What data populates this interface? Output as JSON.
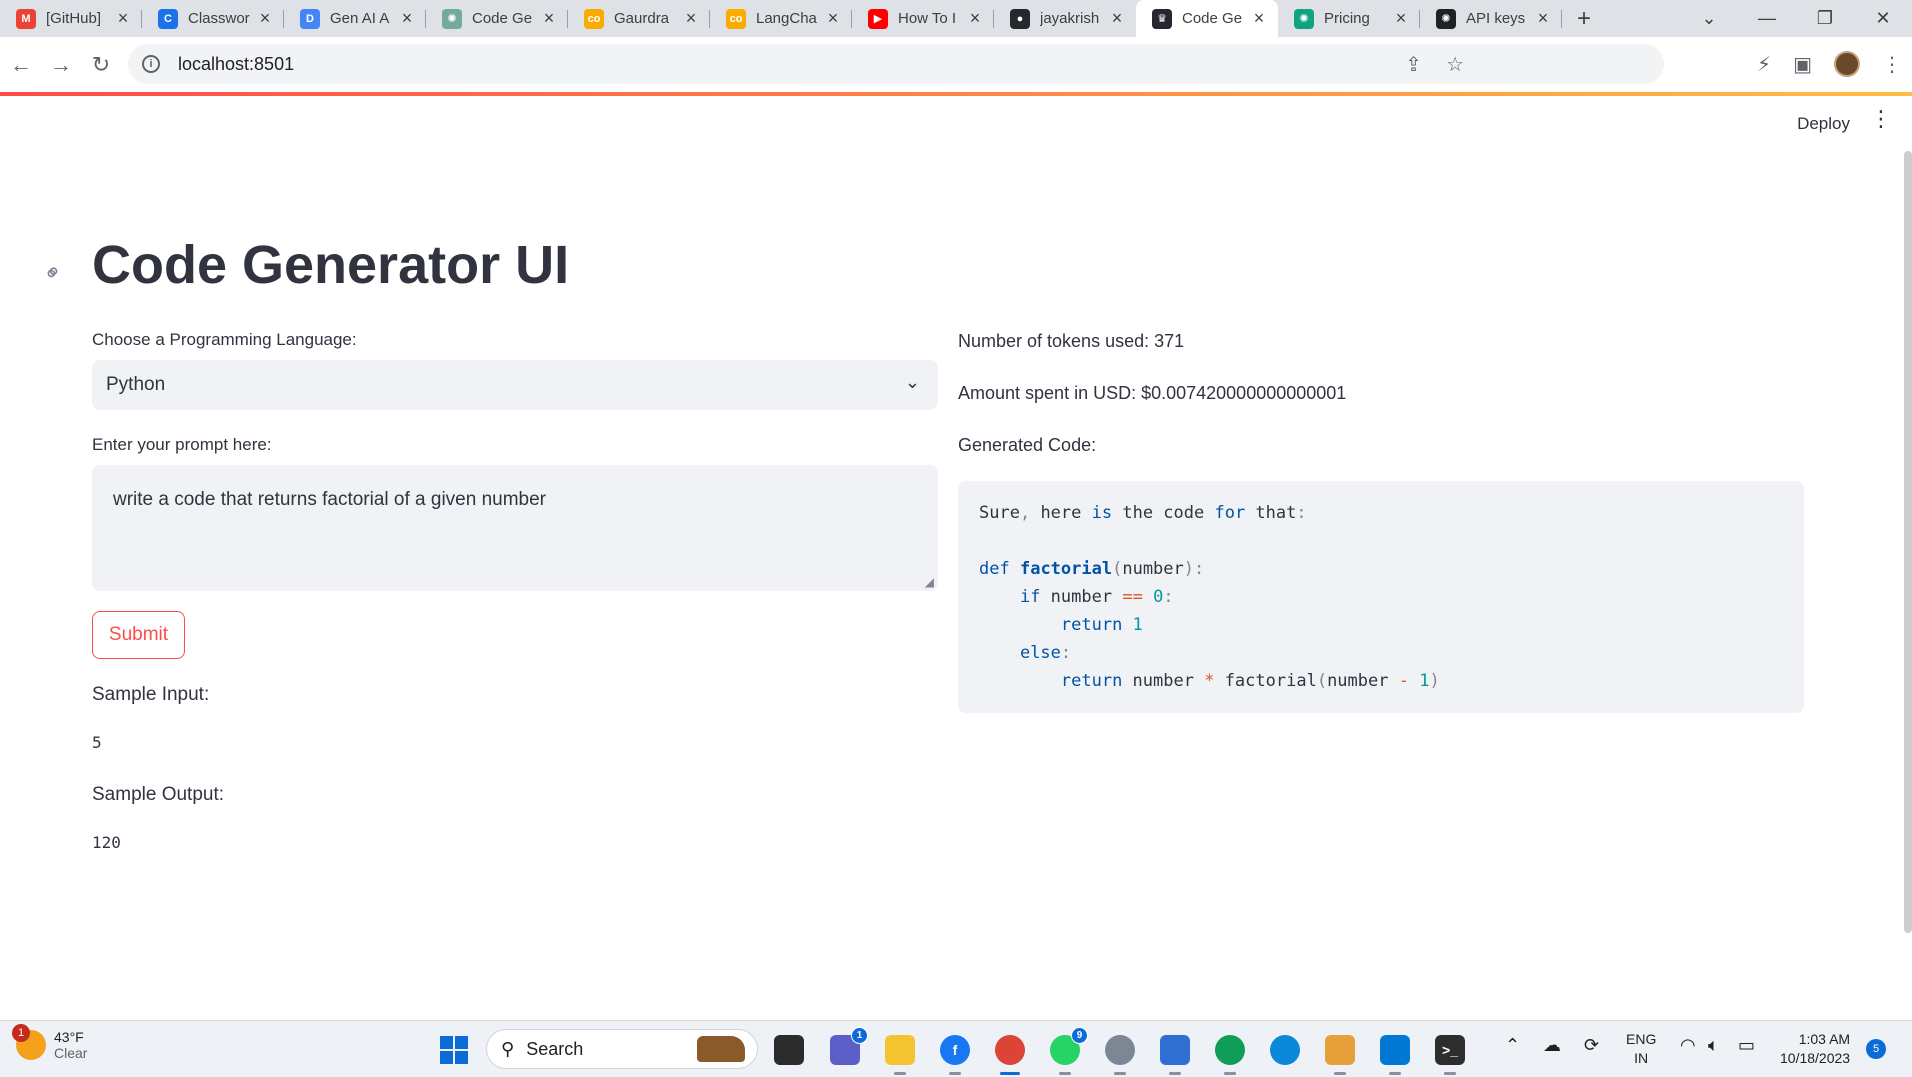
{
  "browser": {
    "tabs": [
      {
        "title": "[GitHub]",
        "icon": "gmail-icon",
        "color": "#ea4335"
      },
      {
        "title": "Classwor",
        "icon": "classroom-icon",
        "color": "#1a73e8"
      },
      {
        "title": "Gen AI A",
        "icon": "docs-icon",
        "color": "#4285f4"
      },
      {
        "title": "Code Ge",
        "icon": "openai-icon",
        "color": "#74aa9c"
      },
      {
        "title": "Gaurdra",
        "icon": "colab-icon",
        "color": "#f9ab00"
      },
      {
        "title": "LangCha",
        "icon": "colab-icon",
        "color": "#f9ab00"
      },
      {
        "title": "How To I",
        "icon": "youtube-icon",
        "color": "#ff0000"
      },
      {
        "title": "jayakrish",
        "icon": "github-icon",
        "color": "#24292e"
      },
      {
        "title": "Code Ge",
        "icon": "streamlit-icon",
        "color": "#262730"
      },
      {
        "title": "Pricing",
        "icon": "openai-icon",
        "color": "#10a37f"
      },
      {
        "title": "API keys",
        "icon": "openai-icon",
        "color": "#202123"
      }
    ],
    "active_tab": 8,
    "url": "localhost:8501"
  },
  "app": {
    "header": {
      "deploy_label": "Deploy"
    },
    "title": "Code Generator UI",
    "language_label": "Choose a Programming Language:",
    "language_value": "Python",
    "prompt_label": "Enter your prompt here:",
    "prompt_value": "write a code that returns factorial of a given number",
    "submit_label": "Submit",
    "sample_input_label": "Sample Input:",
    "sample_input_value": "5",
    "sample_output_label": "Sample Output:",
    "sample_output_value": "120",
    "tokens_text": "Number of tokens used: 371",
    "amount_text": "Amount spent in USD: $0.007420000000000001",
    "generated_label": "Generated Code:",
    "code": {
      "line1": "Sure, here is the code for that:",
      "line2": "def factorial(number):",
      "line3": "if number == 0:",
      "line4": "return 1",
      "line5": "else:",
      "line6": "return number * factorial(number - 1)"
    }
  },
  "taskbar": {
    "weather_temp": "43°F",
    "weather_desc": "Clear",
    "weather_badge": "1",
    "search_label": "Search",
    "lang_line1": "ENG",
    "lang_line2": "IN",
    "time": "1:03 AM",
    "date": "10/18/2023",
    "notification_count": "5",
    "teams_badge": "1",
    "whatsapp_badge": "9"
  }
}
